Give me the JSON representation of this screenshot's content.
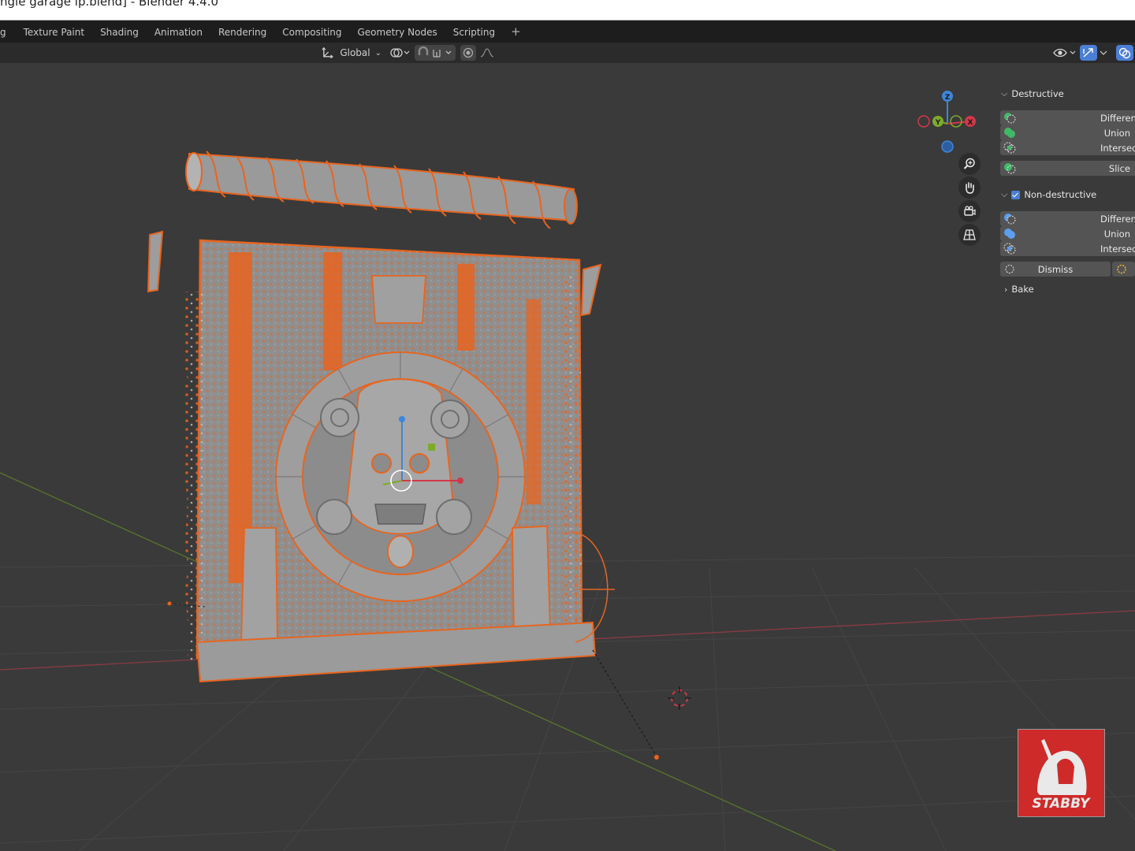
{
  "window": {
    "title": "ngle garage ip.blend] - Blender 4.4.0"
  },
  "workspace_tabs": [
    "g",
    "Texture Paint",
    "Shading",
    "Animation",
    "Rendering",
    "Compositing",
    "Geometry Nodes",
    "Scripting"
  ],
  "workspace_add": "+",
  "header": {
    "transform_orientation": "Global"
  },
  "gizmo": {
    "z": "Z",
    "y": "Y",
    "x": "X"
  },
  "boolean_panel": {
    "destructive_label": "Destructive",
    "destructive_items": [
      "Difference",
      "Union",
      "Intersect"
    ],
    "slice_label": "Slice",
    "non_destructive_label": "Non-destructive",
    "non_destructive_checked": true,
    "non_destructive_items": [
      "Difference",
      "Union",
      "Intersect"
    ],
    "dismiss_label": "Dismiss",
    "bake_label": "Bake"
  },
  "logo": {
    "text": "STABBY"
  },
  "colors": {
    "selection": "#e8641f",
    "viewport_bg": "#3a3a3a",
    "x_axis": "#d23848",
    "y_axis": "#7cab2a",
    "z_axis": "#3d86d9",
    "logo_red": "#cf2a2a",
    "green_icon": "#3fba67",
    "blue_icon": "#5c9ef0"
  }
}
